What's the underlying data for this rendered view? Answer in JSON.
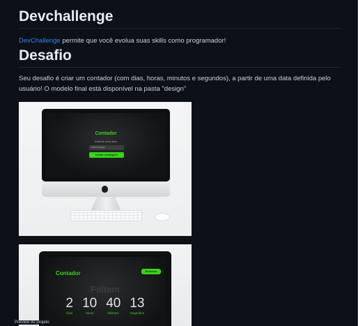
{
  "readme": {
    "heading1": "Devchallenge",
    "intro_link": "DevChallenge",
    "intro_text": " permite que você evolua suas skills como programador!",
    "heading2": "Desafio",
    "desafio_text": "Seu desafio é criar um contador (com dias, horas, minutos e segundos), a partir de uma data definida pelo usuário! O modelo final está disponível na pasta \"design\""
  },
  "image1": {
    "screen_title": "Contador",
    "screen_subtitle": "Informe uma data",
    "input_placeholder": "dd/mm/aaaa",
    "button_label": "Iniciar contagem"
  },
  "image2": {
    "logo": "Contador",
    "button_label": "Reiniciar",
    "faltam": "Faltam",
    "counts": [
      {
        "value": "2",
        "label": "Dias"
      },
      {
        "value": "10",
        "label": "Horas"
      },
      {
        "value": "40",
        "label": "Minutos"
      },
      {
        "value": "13",
        "label": "Segundos"
      }
    ]
  },
  "colors": {
    "background": "#0d1117",
    "link": "#2f81f7",
    "accent_green": "#39d31c"
  },
  "caption": "Preview do projeto"
}
